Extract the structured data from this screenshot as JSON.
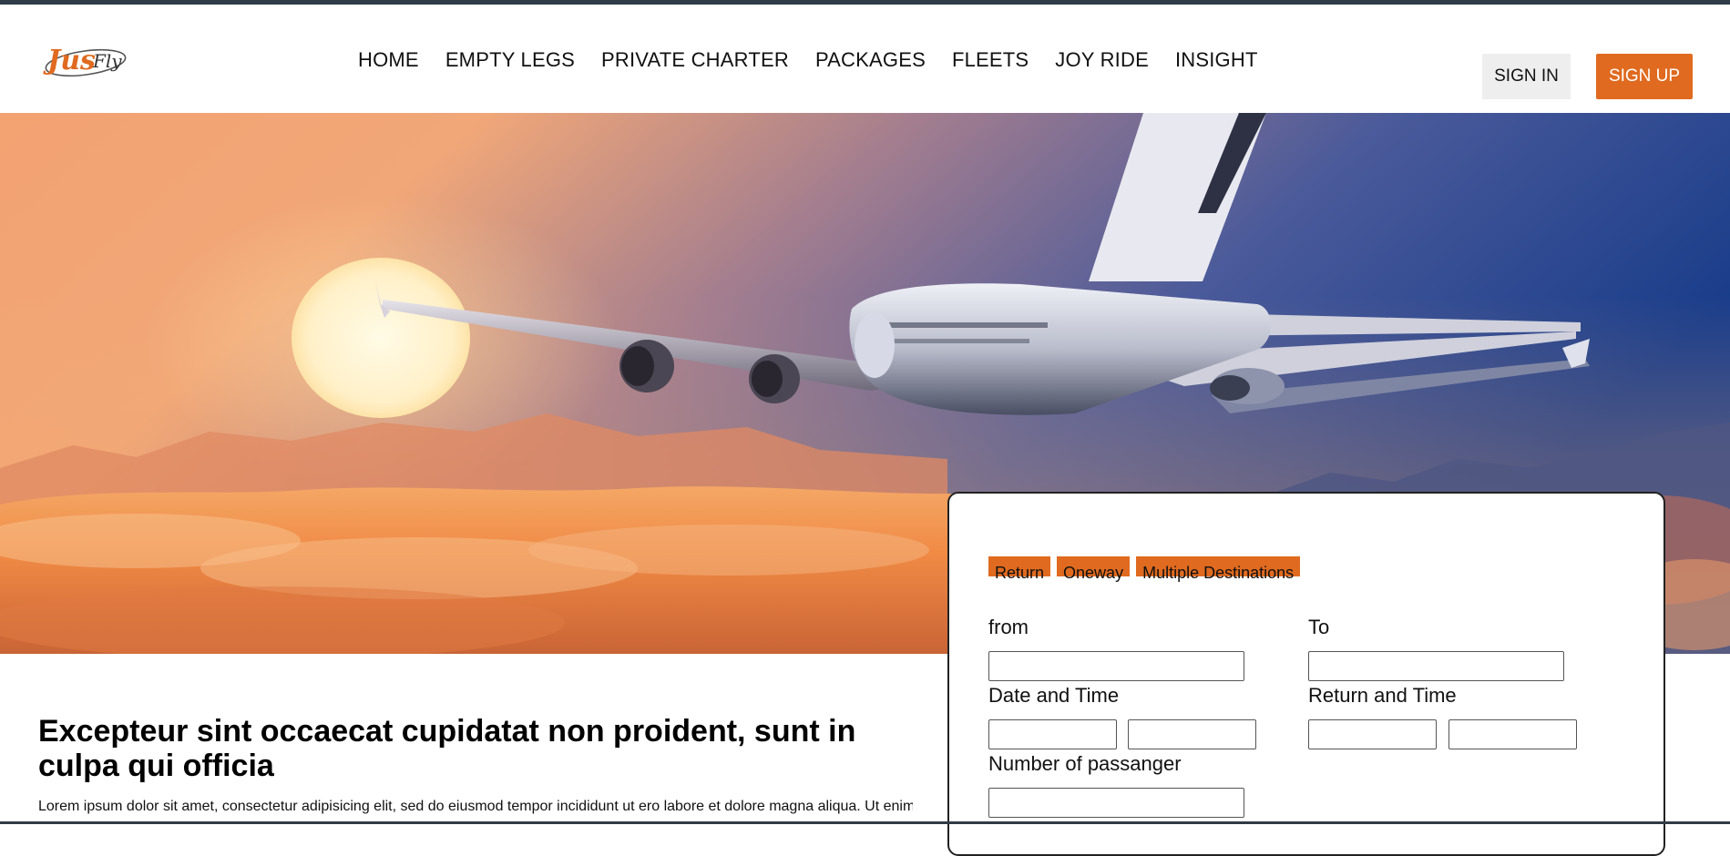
{
  "brand": {
    "logo_text_primary": "Jus",
    "logo_text_secondary": "Fly",
    "accent_color": "#e06a1f"
  },
  "nav": {
    "items": [
      {
        "label": "HOME"
      },
      {
        "label": "EMPTY LEGS"
      },
      {
        "label": "PRIVATE CHARTER"
      },
      {
        "label": "PACKAGES"
      },
      {
        "label": "FLEETS"
      },
      {
        "label": "JOY RIDE"
      },
      {
        "label": "INSIGHT"
      }
    ]
  },
  "auth": {
    "sign_in_label": "SIGN IN",
    "sign_up_label": "SIGN UP"
  },
  "booking": {
    "trip_types": [
      {
        "label": "Return"
      },
      {
        "label": "Oneway"
      },
      {
        "label": "Multiple Destinations"
      }
    ],
    "from_label": "from",
    "to_label": "To",
    "date_time_label": "Date and Time",
    "return_time_label": "Return and Time",
    "passenger_label": "Number of passanger",
    "from_value": "",
    "to_value": "",
    "date_value": "",
    "time_value": "",
    "return_date_value": "",
    "return_time_value": "",
    "passenger_value": ""
  },
  "content": {
    "title": "Excepteur sint occaecat cupidatat non proident, sunt in culpa qui officia",
    "body": "Lorem ipsum dolor sit amet, consectetur adipisicing elit, sed do eiusmod tempor incididunt ut ero labore et dolore magna aliqua. Ut enim ad minim veniam, quis nostrud exercitation ullamco laboris nisi ut aliquip ex ea commodo consequat."
  }
}
